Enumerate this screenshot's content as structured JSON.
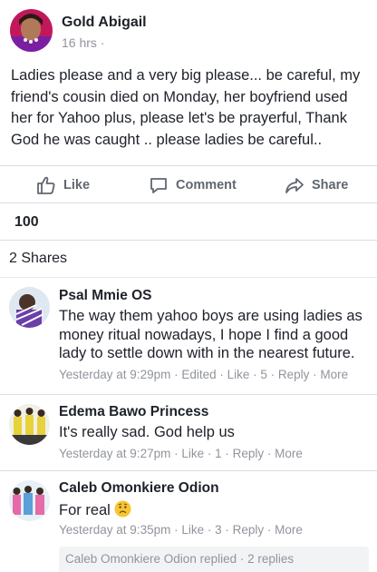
{
  "post": {
    "author": "Gold Abigail",
    "time": "16 hrs ·",
    "body": "Ladies please and a very big please... be careful, my friend's cousin died on Monday, her boyfriend used her for Yahoo plus, please let's be prayerful, Thank God he was caught .. please ladies be careful..",
    "actions": {
      "like": "Like",
      "comment": "Comment",
      "share": "Share"
    },
    "reaction_count": "100",
    "shares": "2 Shares"
  },
  "comments": [
    {
      "name": "Psal Mmie OS",
      "text": "The way them yahoo boys are using ladies as money ritual nowadays, I hope I find a good lady to settle down with in the nearest future.",
      "meta": "Yesterday at 9:29pm · Edited · Like · 5 · Reply · More"
    },
    {
      "name": "Edema Bawo Princess",
      "text": "It's really sad. God help us",
      "meta": "Yesterday at 9:27pm · Like · 1 · Reply · More"
    },
    {
      "name": "Caleb Omonkiere Odion",
      "text": "For real",
      "emoji": "worried-face-icon",
      "meta": "Yesterday at 9:35pm · Like · 3 · Reply · More",
      "replies": "Caleb Omonkiere Odion replied · 2 replies"
    }
  ],
  "colors": {
    "text": "#1d2129",
    "secondary": "#90949c",
    "action": "#606770",
    "background": "#e9ebee"
  }
}
